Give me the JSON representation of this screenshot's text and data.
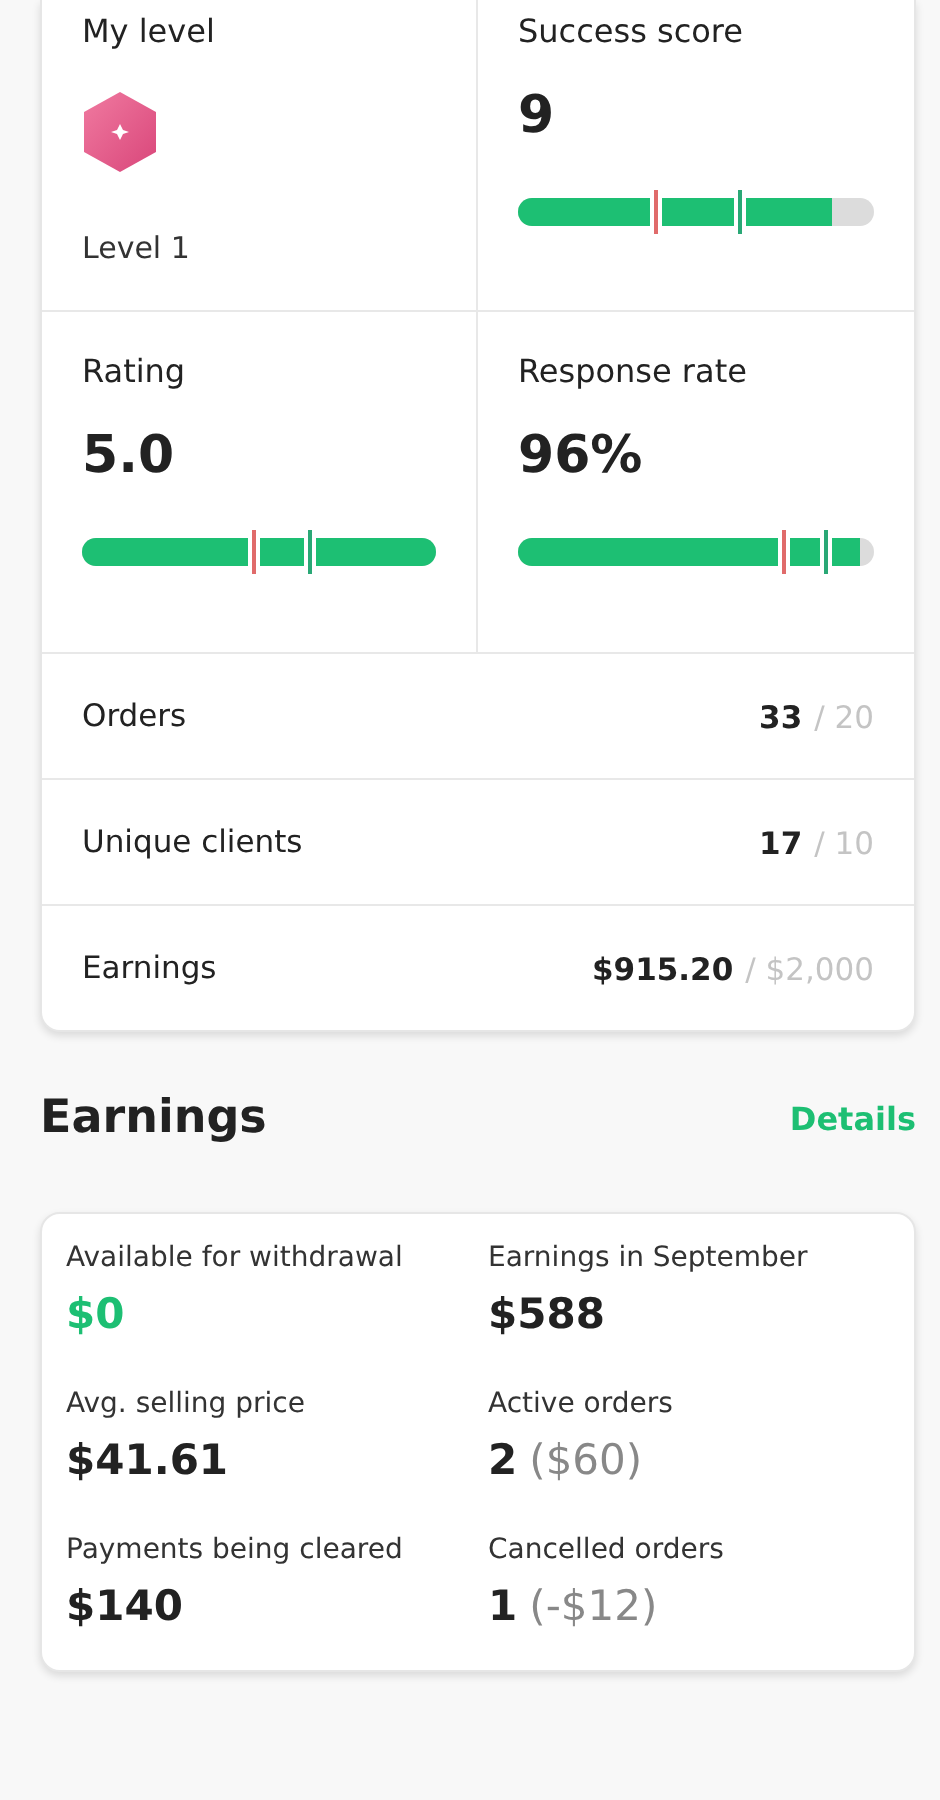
{
  "level_card": {
    "tiles": [
      {
        "kind": "badge",
        "title": "My level",
        "caption": "Level 1"
      },
      {
        "kind": "meter",
        "title": "Success score",
        "value": "9",
        "level": 0.88,
        "markers": [
          {
            "color": "#e06b6b",
            "level": 0.38
          },
          {
            "color": "#2aa876",
            "level": 0.62
          }
        ]
      },
      {
        "kind": "meter",
        "title": "Rating",
        "value": "5.0",
        "level": 1,
        "markers": [
          {
            "color": "#e06b6b",
            "level": 0.48
          },
          {
            "color": "#2aa876",
            "level": 0.64
          }
        ]
      },
      {
        "kind": "meter",
        "title": "Response rate",
        "value": "96%",
        "level": 0.96,
        "markers": [
          {
            "color": "#e06b6b",
            "level": 0.74
          },
          {
            "color": "#2aa876",
            "level": 0.86
          }
        ]
      }
    ],
    "rows": [
      {
        "label": "Orders",
        "value": "33",
        "target": "/ 20"
      },
      {
        "label": "Unique clients",
        "value": "17",
        "target": "/ 10"
      },
      {
        "label": "Earnings",
        "value": "$915.20",
        "target": "/ $2,000"
      }
    ]
  },
  "earnings": {
    "title": "Earnings",
    "link": "Details",
    "stats": [
      {
        "label": "Available for withdrawal",
        "value": "$0",
        "highlight": true
      },
      {
        "label": "Earnings in September",
        "value": "$588",
        "highlight": false
      },
      {
        "label": "Avg. selling price",
        "value": "$41.61",
        "highlight": false
      },
      {
        "label": "Active orders",
        "value": "2",
        "note": "($60)",
        "highlight": false
      },
      {
        "label": "Payments being cleared",
        "value": "$140",
        "highlight": false
      },
      {
        "label": "Cancelled orders",
        "value": "1",
        "note": "(-$12)",
        "highlight": false
      }
    ]
  }
}
